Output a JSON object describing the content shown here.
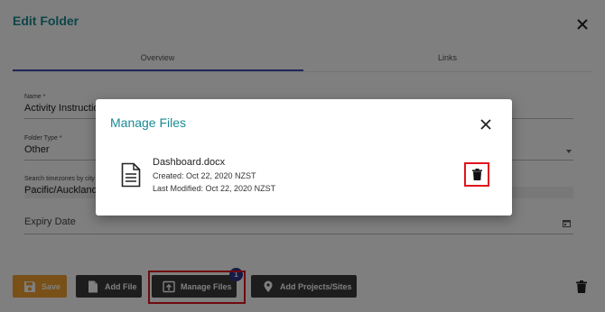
{
  "dialog": {
    "title": "Edit Folder",
    "tabs": [
      {
        "label": "Overview",
        "active": true
      },
      {
        "label": "Links",
        "active": false
      }
    ]
  },
  "form": {
    "name": {
      "label": "Name *",
      "value": "Activity Instructions"
    },
    "folder_type": {
      "label": "Folder Type *",
      "value": "Other"
    },
    "timezone": {
      "label": "Search timezones by city",
      "value": "Pacific/Auckland"
    },
    "expiry": {
      "placeholder": "Expiry Date"
    }
  },
  "buttons": {
    "save": "Save",
    "add_file": "Add File",
    "manage_files": "Manage Files",
    "manage_files_badge": "1",
    "add_projects": "Add Projects/Sites"
  },
  "modal": {
    "title": "Manage Files",
    "files": [
      {
        "name": "Dashboard.docx",
        "created": "Created: Oct 22, 2020 NZST",
        "modified": "Last Modified: Oct 22, 2020 NZST"
      }
    ]
  },
  "colors": {
    "accent": "#1a8a93",
    "save_button": "#f0a030",
    "dark_button": "#3a3a3a",
    "badge": "#2a3590",
    "highlight": "#e0141e"
  }
}
